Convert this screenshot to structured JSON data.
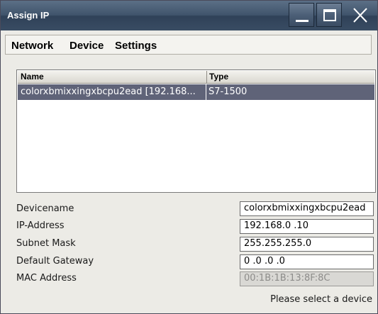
{
  "window": {
    "title": "Assign IP"
  },
  "menu": {
    "items": [
      "Network",
      "Device",
      "Settings"
    ]
  },
  "device_list": {
    "columns": [
      "Name",
      "Type"
    ],
    "rows": [
      {
        "name": "colorxbmixxingxbcpu2ead [192.168...",
        "type": "S7-1500",
        "selected": true
      }
    ]
  },
  "form": {
    "devicename": {
      "label": "Devicename",
      "value": "colorxbmixxingxbcpu2ead"
    },
    "ip_address": {
      "label": "IP-Address",
      "value": "192.168.0  .10"
    },
    "subnet_mask": {
      "label": "Subnet Mask",
      "value": "255.255.255.0"
    },
    "default_gateway": {
      "label": "Default Gateway",
      "value": "0  .0  .0  .0"
    },
    "mac_address": {
      "label": "MAC Address",
      "value": "00:1B:1B:13:8F:8C",
      "disabled": true
    }
  },
  "status": "Please select a device",
  "colors": {
    "titlebar": "#40546c",
    "selection": "#5f6378",
    "window_bg": "#ecebe6"
  }
}
